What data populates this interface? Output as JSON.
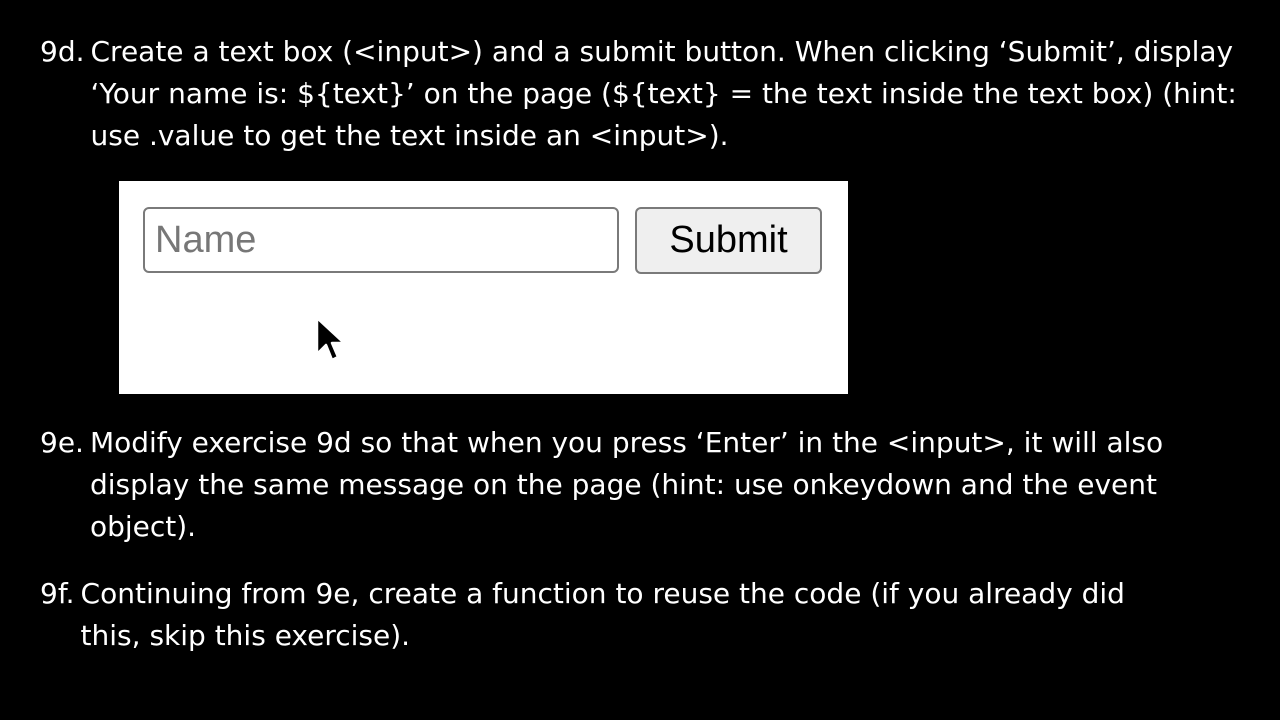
{
  "exercises": [
    {
      "number": "9d.",
      "text": "Create a text box (<input>) and a submit button. When clicking ‘Submit’, display ‘Your name is: ${text}’ on the page (${text} = the text inside the text box) (hint: use .value to get the text inside an <input>)."
    },
    {
      "number": "9e.",
      "text": "Modify exercise 9d so that when you press ‘Enter’ in the <input>, it will also display the same message on the page (hint: use onkeydown and the event object)."
    },
    {
      "number": "9f.",
      "text": "Continuing from 9e, create a function to reuse the code (if you already did this, skip this exercise)."
    }
  ],
  "demo": {
    "input_value": "",
    "input_placeholder": "Name",
    "submit_label": "Submit"
  },
  "icons": {
    "cursor": "arrow-cursor-icon"
  },
  "colors": {
    "background": "#000000",
    "text": "#ffffff",
    "panel": "#ffffff",
    "border": "#7a7a7a",
    "button_bg": "#efefef"
  }
}
